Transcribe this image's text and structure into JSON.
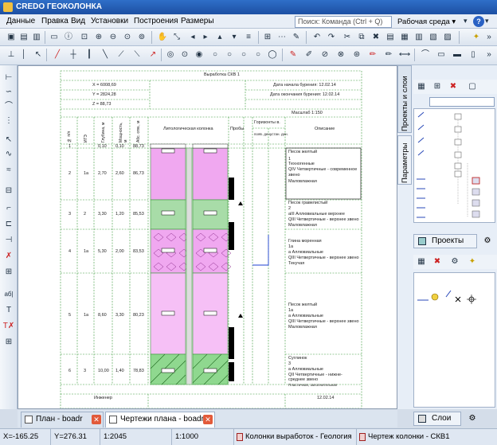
{
  "app": {
    "title": "CREDO ГЕОКОЛОНКА"
  },
  "menu": [
    "Данные",
    "Правка",
    "Вид",
    "Установки",
    "Построения",
    "Размеры"
  ],
  "command": {
    "placeholder": "Поиск: Команда (Ctrl + Q)"
  },
  "workspace": {
    "label": "Рабочая среда"
  },
  "sheet": {
    "header": "Выработка СКВ 1",
    "x_coord": "X = 6008,69",
    "y_coord": "Y = 2824,28",
    "z_coord": "Z = 88,73",
    "start_drill": "Дата начала бурения: 12.02.14",
    "end_drill": "Дата окончания бурения: 12.02.14",
    "scale": "Масштаб 1:150",
    "col_headers": [
      "№ п/п",
      "ИГЭ",
      "Глубина, м",
      "Мощность, м",
      "Абс. отм., м",
      "Литологическая колонка",
      "Пробы",
      "Горизонты в.",
      "Описание"
    ],
    "subcols": [
      "появ. ден.",
      "устан. ден."
    ],
    "top_row": [
      "1",
      "",
      "0,10",
      "0,10",
      "88,73"
    ],
    "rows": [
      {
        "n": "2",
        "ige": "1а",
        "depth": "2,70",
        "thick": "2,60",
        "abs": "86,73",
        "desc": [
          "Песок желтый",
          "1",
          "Техногенные",
          "QIV Четвертичные - современное",
          "звено",
          "Маловлажная"
        ]
      },
      {
        "n": "3",
        "ige": "2",
        "depth": "3,30",
        "thick": "1,20",
        "abs": "85,53",
        "desc": [
          "Песок гравелистый",
          "2",
          "aIII Аллювиальные верхнее",
          "QIII Четвертичные - верхнее звено",
          "Маловлажная"
        ]
      },
      {
        "n": "4",
        "ige": "1а",
        "depth": "5,30",
        "thick": "2,00",
        "abs": "83,53",
        "desc": [
          "Глина моренная",
          "1а",
          "a Аллювиальные",
          "QIII Четвертичные - верхнее звено",
          "Текучая"
        ]
      },
      {
        "n": "5",
        "ige": "1а",
        "depth": "8,60",
        "thick": "3,30",
        "abs": "80,23",
        "desc": [
          "Песок желтый",
          "1а",
          "a Аллювиальные",
          "QIII Четвертичные - верхнее звено",
          "Маловлажная"
        ]
      },
      {
        "n": "6",
        "ige": "3",
        "depth": "10,00",
        "thick": "1,40",
        "abs": "78,83",
        "desc": [
          "Суглинок",
          "3",
          "a Аллювиальные",
          "QII Четвертичные - нижне-",
          "среднее звено",
          "Пластичная, заполнительная"
        ]
      }
    ],
    "footer_left": "Инженер",
    "footer_right": "12.02.14"
  },
  "right_panel": {
    "tab_projects_layers": "Проекты и слои",
    "tab_params": "Параметры",
    "projects_btn": "Проекты",
    "layers_btn": "Слои"
  },
  "doc_tabs": [
    {
      "label": "План - boadr"
    },
    {
      "label": "Чертежи плана - boadr"
    }
  ],
  "status": {
    "x": "X=-165.25",
    "y": "Y=276.31",
    "ratio": "1:2045",
    "scale": "1:1000",
    "layer1": "Колонки выработок - Геология",
    "layer2": "Чертеж колонки - СКВ1"
  },
  "left_tools_text": [
    "аб|"
  ]
}
